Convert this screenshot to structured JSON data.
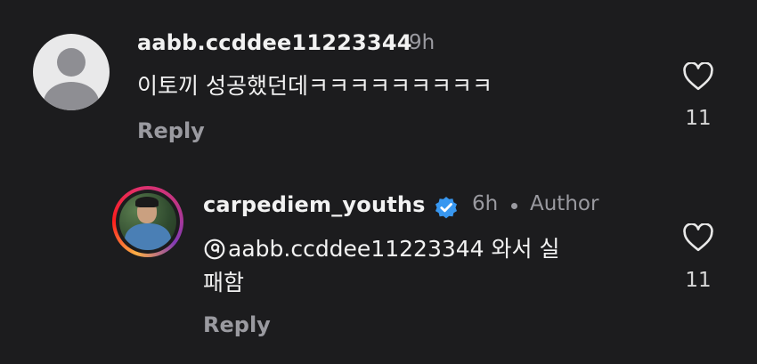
{
  "comments": [
    {
      "username": "aabb.ccddee11223344",
      "time": "9h",
      "text": "이토끼 성공했던데ㅋㅋㅋㅋㅋㅋㅋㅋㅋ",
      "reply_label": "Reply",
      "likes": "11",
      "avatar": "default-avatar-icon"
    }
  ],
  "reply": {
    "username": "carpediem_youths",
    "verified_icon": "verified-badge-icon",
    "time": "6h",
    "author_label": "Author",
    "mention": "aabb.ccddee11223344",
    "text_line1_suffix": " 와서 실",
    "text_line2": "패함",
    "reply_label": "Reply",
    "likes": "11",
    "avatar": "profile-photo"
  },
  "colors": {
    "background": "#1c1c1e",
    "verified": "#3897f0",
    "muted": "#9a9aa0"
  }
}
